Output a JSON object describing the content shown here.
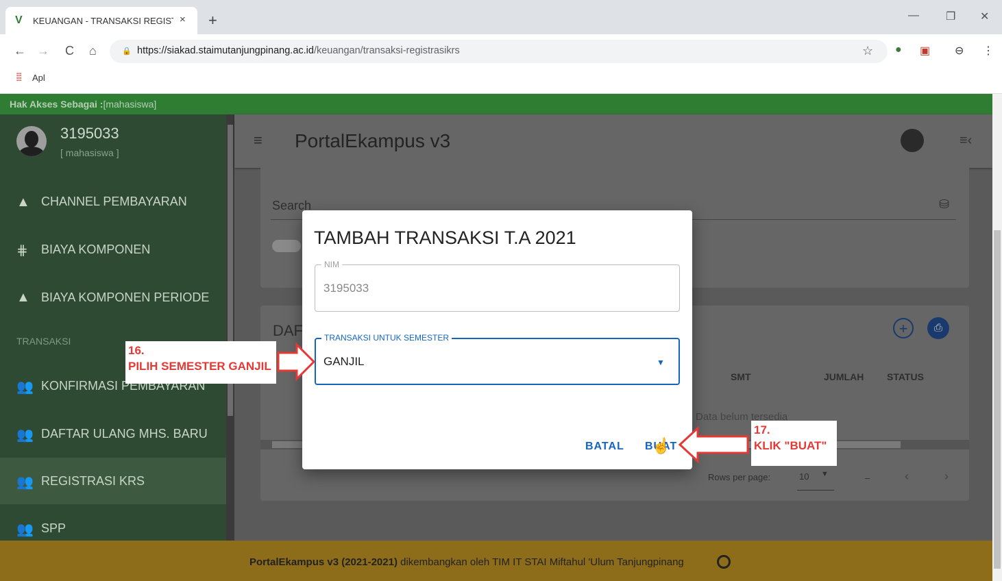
{
  "browser": {
    "tab_title": "KEUANGAN - TRANSAKSI REGISTRASI KRS",
    "tab_logo": "V",
    "tab_close": "×",
    "new_tab": "+",
    "url_host": "https://siakad.staimutanjungpinang.ac.id",
    "url_path": "/keuangan/transaksi-registrasikrs",
    "bookmark_apps": "Apl",
    "buttons": {
      "back": "←",
      "forward": "→",
      "reload": "C",
      "home": "⌂",
      "star": "☆",
      "profile": "⊖",
      "menu": "⋮",
      "minimize": "—",
      "maximize": "❐",
      "close": "✕"
    }
  },
  "access": {
    "prefix": "Hak Akses Sebagai :",
    "role": "[mahasiswa]"
  },
  "profile": {
    "user_id": "3195033",
    "role": "[ mahasiswa ]"
  },
  "sidebar": {
    "items": [
      {
        "label": "CHANNEL PEMBAYARAN",
        "icon": "▲"
      },
      {
        "label": "BIAYA KOMPONEN",
        "icon": "⋕"
      },
      {
        "label": "BIAYA KOMPONEN PERIODE",
        "icon": "▲"
      },
      {
        "label": "KONFIRMASI PEMBAYARAN",
        "icon": "👥"
      },
      {
        "label": "DAFTAR ULANG MHS. BARU",
        "icon": "👥"
      },
      {
        "label": "REGISTRASI KRS",
        "icon": "👥"
      },
      {
        "label": "SPP",
        "icon": "👥"
      }
    ],
    "section_header": "TRANSAKSI"
  },
  "app": {
    "title": "PortalEkampus v3"
  },
  "search": {
    "label": "Search"
  },
  "table": {
    "title": "DAF",
    "headers": [
      "SMT",
      "JUMLAH",
      "STATUS"
    ],
    "empty_text": "Data belum tersedia",
    "rows_per_page_label": "Rows per page:",
    "rows_per_page": "10",
    "range": "–"
  },
  "footer": {
    "bold": "PortalEkampus v3 (2021-2021)",
    "text": " dikembangkan oleh TIM IT STAI Miftahul 'Ulum Tanjungpinang"
  },
  "dialog": {
    "title": "TAMBAH TRANSAKSI T.A 2021",
    "nim_label": "NIM",
    "nim_value": "3195033",
    "semester_label": "TRANSAKSI UNTUK SEMESTER",
    "semester_value": "GANJIL",
    "cancel": "BATAL",
    "create": "BUAT"
  },
  "annotations": {
    "step16_number": "16.",
    "step16_text": "PILIH SEMESTER GANJIL",
    "step17_number": "17.",
    "step17_text": "KLIK \"BUAT\""
  },
  "colors": {
    "sidebar_green": "#2e7d32",
    "footer_gold": "#c9a227",
    "accent_blue": "#1565c0",
    "annotation_red": "#e53935"
  }
}
